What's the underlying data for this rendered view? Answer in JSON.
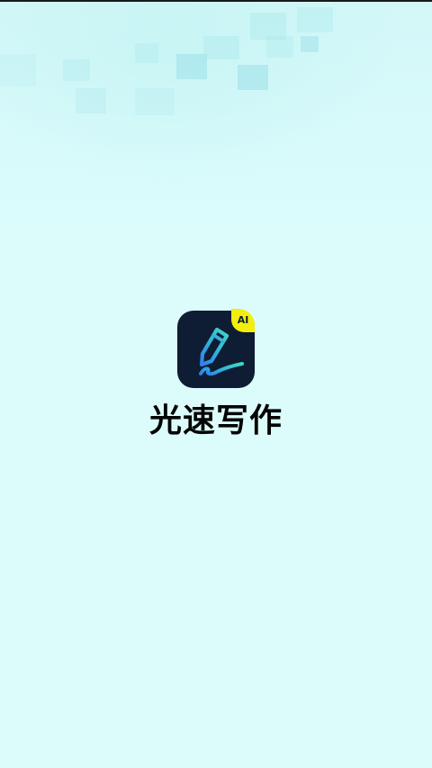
{
  "splash": {
    "app_name": "光速写作",
    "badge": "AI",
    "icon": "pen-writing-icon"
  },
  "colors": {
    "background": "#dcfcfc",
    "icon_background": "#0e1d33",
    "badge": "#f2ef0c",
    "icon_gradient_start": "#3fd6c4",
    "icon_gradient_end": "#2f7ff0",
    "text": "#050505"
  }
}
